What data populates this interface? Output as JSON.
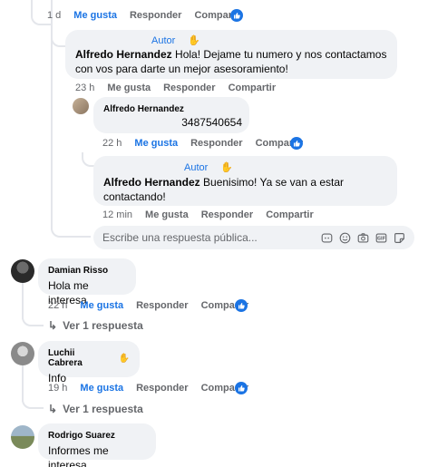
{
  "top_comment": {
    "time": "1 d",
    "like_label": "Me gusta",
    "reply_label": "Responder",
    "share_label": "Compartir"
  },
  "replies": [
    {
      "author": "Alfredo Hernandez",
      "badge": "Autor",
      "text": "Hola! Dejame tu numero y nos contactamos con vos para darte un mejor asesoramiento!",
      "time": "23 h",
      "like_label": "Me gusta",
      "reply_label": "Responder",
      "share_label": "Compartir"
    },
    {
      "author": "Alfredo Hernandez",
      "text": "3487540654",
      "time": "22 h",
      "like_label": "Me gusta",
      "reply_label": "Responder",
      "share_label": "Compartir"
    },
    {
      "author": "Alfredo Hernandez",
      "badge": "Autor",
      "text": "Buenisimo! Ya se van a estar contactando!",
      "time": "12 min",
      "like_label": "Me gusta",
      "reply_label": "Responder",
      "share_label": "Compartir"
    }
  ],
  "reply_input": {
    "placeholder": "Escribe una respuesta pública..."
  },
  "comments": [
    {
      "author": "Damian Risso",
      "text": "Hola me interesa",
      "time": "22 h",
      "like_label": "Me gusta",
      "reply_label": "Responder",
      "share_label": "Compartir",
      "view_replies": "Ver 1 respuesta"
    },
    {
      "author": "Luchii Cabrera",
      "text": "Info",
      "time": "19 h",
      "like_label": "Me gusta",
      "reply_label": "Responder",
      "share_label": "Compartir",
      "view_replies": "Ver 1 respuesta"
    },
    {
      "author": "Rodrigo Suarez",
      "text": "Informes me interesa"
    }
  ],
  "colors": {
    "accent": "#1b74e4",
    "bubble": "#f0f2f5",
    "muted": "#65676b"
  }
}
